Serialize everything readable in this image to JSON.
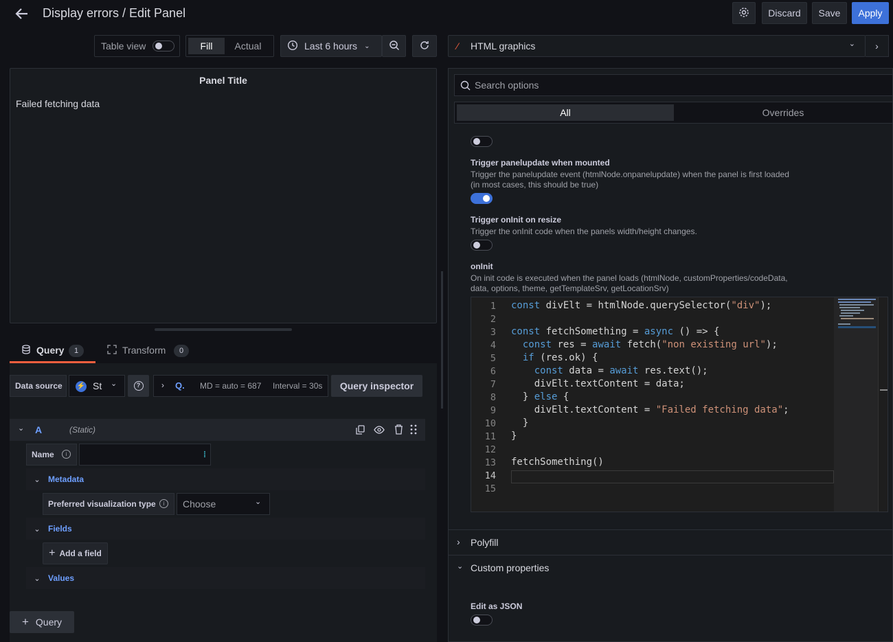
{
  "header": {
    "title": "Display errors / Edit Panel",
    "discard": "Discard",
    "save": "Save",
    "apply": "Apply"
  },
  "toolbar": {
    "table_view": "Table view",
    "fill": "Fill",
    "actual": "Actual",
    "time_range": "Last 6 hours"
  },
  "viz_picker": {
    "name": "HTML graphics"
  },
  "panel": {
    "title": "Panel Title",
    "content": "Failed fetching data"
  },
  "tabs": {
    "query": "Query",
    "query_count": "1",
    "transform": "Transform",
    "transform_count": "0"
  },
  "datasource": {
    "label": "Data source",
    "value": "St",
    "options_q": "Q.",
    "md": "MD = auto = 687",
    "interval": "Interval = 30s",
    "inspector": "Query inspector"
  },
  "query_row": {
    "ref": "A",
    "type": "(Static)"
  },
  "fields": {
    "name_label": "Name",
    "metadata": "Metadata",
    "pref_viz": "Preferred visualization type",
    "choose": "Choose",
    "fields": "Fields",
    "add_field": "Add a field",
    "values": "Values"
  },
  "add_query": "Query",
  "options": {
    "search_placeholder": "Search options",
    "tab_all": "All",
    "tab_overrides": "Overrides"
  },
  "settings": {
    "trigger_update_title": "Trigger panelupdate when mounted",
    "trigger_update_desc1": "Trigger the panelupdate event (htmlNode.onpanelupdate) when the panel is first loaded",
    "trigger_update_desc2": "(in most cases, this should be true)",
    "trigger_resize_title": "Trigger onInit on resize",
    "trigger_resize_desc": "Trigger the onInit code when the panels width/height changes.",
    "oninit_title": "onInit",
    "oninit_desc1": "On init code is executed when the panel loads (htmlNode, customProperties/codeData,",
    "oninit_desc2": "data, options, theme, getTemplateSrv, getLocationSrv)",
    "polyfill": "Polyfill",
    "custom_props": "Custom properties",
    "edit_json": "Edit as JSON"
  },
  "code": {
    "line_numbers": [
      "1",
      "2",
      "3",
      "4",
      "5",
      "6",
      "7",
      "8",
      "9",
      "10",
      "11",
      "12",
      "13",
      "14",
      "15"
    ],
    "l1": "const divElt = htmlNode.querySelector(\"div\");",
    "l3": "const fetchSomething = async () => {",
    "l4": "  const res = await fetch(\"non existing url\");",
    "l5": "  if (res.ok) {",
    "l6": "    const data = await res.text();",
    "l7": "    divElt.textContent = data;",
    "l8": "  } else {",
    "l9": "    divElt.textContent = \"Failed fetching data\";",
    "l10": "  }",
    "l11": "}",
    "l13": "fetchSomething()"
  }
}
